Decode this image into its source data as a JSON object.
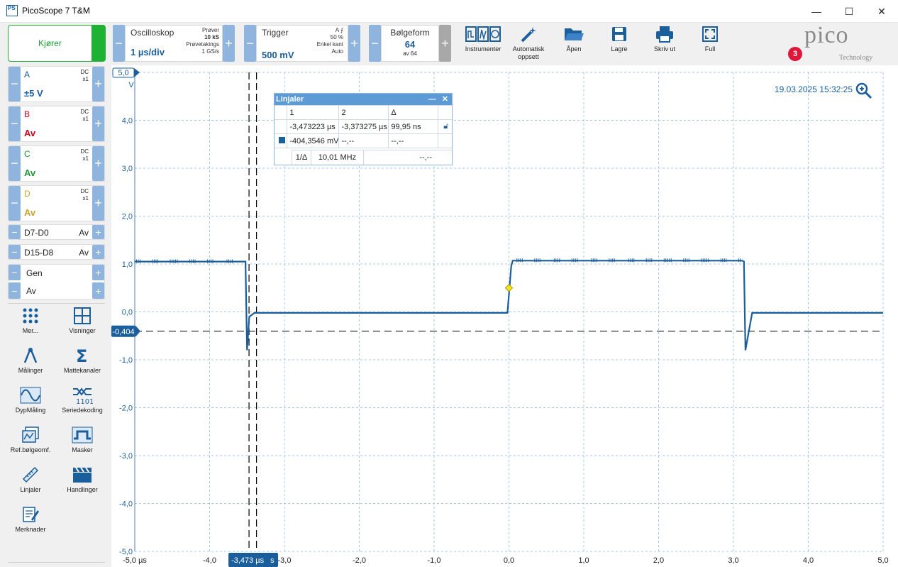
{
  "app": {
    "title": "PicoScope 7 T&M",
    "logo_text": "PS"
  },
  "toolbar": {
    "run_label": "Kjører",
    "scope": {
      "label": "Oscilloskop",
      "value": "1 µs/div",
      "samples_label": "Prøver",
      "samples": "10 kS",
      "rate_label": "Prøvetakings",
      "rate": "1 GS/s"
    },
    "trigger": {
      "label": "Trigger",
      "value": "500 mV",
      "mode": "A",
      "pct": "50 %",
      "type": "Enkel kant",
      "auto": "Auto"
    },
    "waveform": {
      "label": "Bølgeform",
      "value": "64",
      "of": "av 64"
    },
    "tools": [
      "Instrumenter",
      "Automatisk oppsett",
      "Åpen",
      "Lagre",
      "Skriv ut",
      "Full"
    ],
    "brand": {
      "name": "pico",
      "sub": "Technology",
      "badge": "3"
    }
  },
  "channels": [
    {
      "name": "A",
      "coupling": "DC",
      "probe": "x1",
      "range": "±5 V",
      "color": "#1b5e9c"
    },
    {
      "name": "B",
      "coupling": "DC",
      "probe": "x1",
      "range": "Av",
      "color": "#d0021b"
    },
    {
      "name": "C",
      "coupling": "DC",
      "probe": "x1",
      "range": "Av",
      "color": "#1f9a3a"
    },
    {
      "name": "D",
      "coupling": "DC",
      "probe": "x1",
      "range": "Av",
      "color": "#c8a233"
    }
  ],
  "digital": [
    {
      "name": "D7-D0",
      "state": "Av"
    },
    {
      "name": "D15-D8",
      "state": "Av"
    }
  ],
  "gen": {
    "label": "Gen",
    "state": "Av"
  },
  "side_buttons": [
    "Mer...",
    "Visninger",
    "Målinger",
    "Mattekanaler",
    "DypMåling",
    "Seriedekoding",
    "Ref.bølgeomf.",
    "Masker",
    "Linjaler",
    "Handlinger",
    "Merknader"
  ],
  "plot": {
    "timestamp": "19.03.2025 15:32:25",
    "y_unit": "V",
    "y_top_label": "5,0",
    "y_ticks": [
      "4,0",
      "3,0",
      "2,0",
      "1,0",
      "0,0",
      "-1,0",
      "-2,0",
      "-3,0",
      "-4,0",
      "-5,0"
    ],
    "x_ticks": [
      "-5,0 µs",
      "-4,0",
      "-3,0",
      "-2,0",
      "-1,0",
      "0,0",
      "1,0",
      "2,0",
      "3,0",
      "4,0",
      "5,0"
    ],
    "ruler_level_label": "-0,404",
    "ruler_time_label": "-3,473 µs",
    "ruler_time_suffix": "s",
    "accent": "#1b5e9c"
  },
  "chart_data": {
    "type": "line",
    "xlabel": "µs",
    "ylabel": "V",
    "xlim": [
      -5.0,
      5.0
    ],
    "ylim": [
      -5.0,
      5.0
    ],
    "grid": true,
    "series": [
      {
        "name": "A",
        "x": [
          -5.0,
          -3.52,
          -3.5,
          -3.47,
          -3.4,
          -0.02,
          0.03,
          0.05,
          3.12,
          3.14,
          3.16,
          3.25,
          5.0
        ],
        "y": [
          1.05,
          1.05,
          -0.8,
          -0.1,
          -0.02,
          -0.02,
          0.95,
          1.07,
          1.07,
          1.05,
          -0.8,
          -0.02,
          -0.02
        ]
      }
    ],
    "trigger_point": {
      "x": 0.0,
      "y": 0.5
    },
    "ruler_level": -0.404
  },
  "ruler_panel": {
    "title": "Linjaler",
    "headers": [
      "1",
      "2",
      "Δ"
    ],
    "time_row": [
      "-3,473223 µs",
      "-3,373275 µs",
      "99,95 ns"
    ],
    "level_row": [
      "-404,3546 mV",
      "--,--",
      "--,--"
    ],
    "freq_label": "1/Δ",
    "freq_value": "10,01 MHz",
    "freq_extra": "--,--"
  }
}
